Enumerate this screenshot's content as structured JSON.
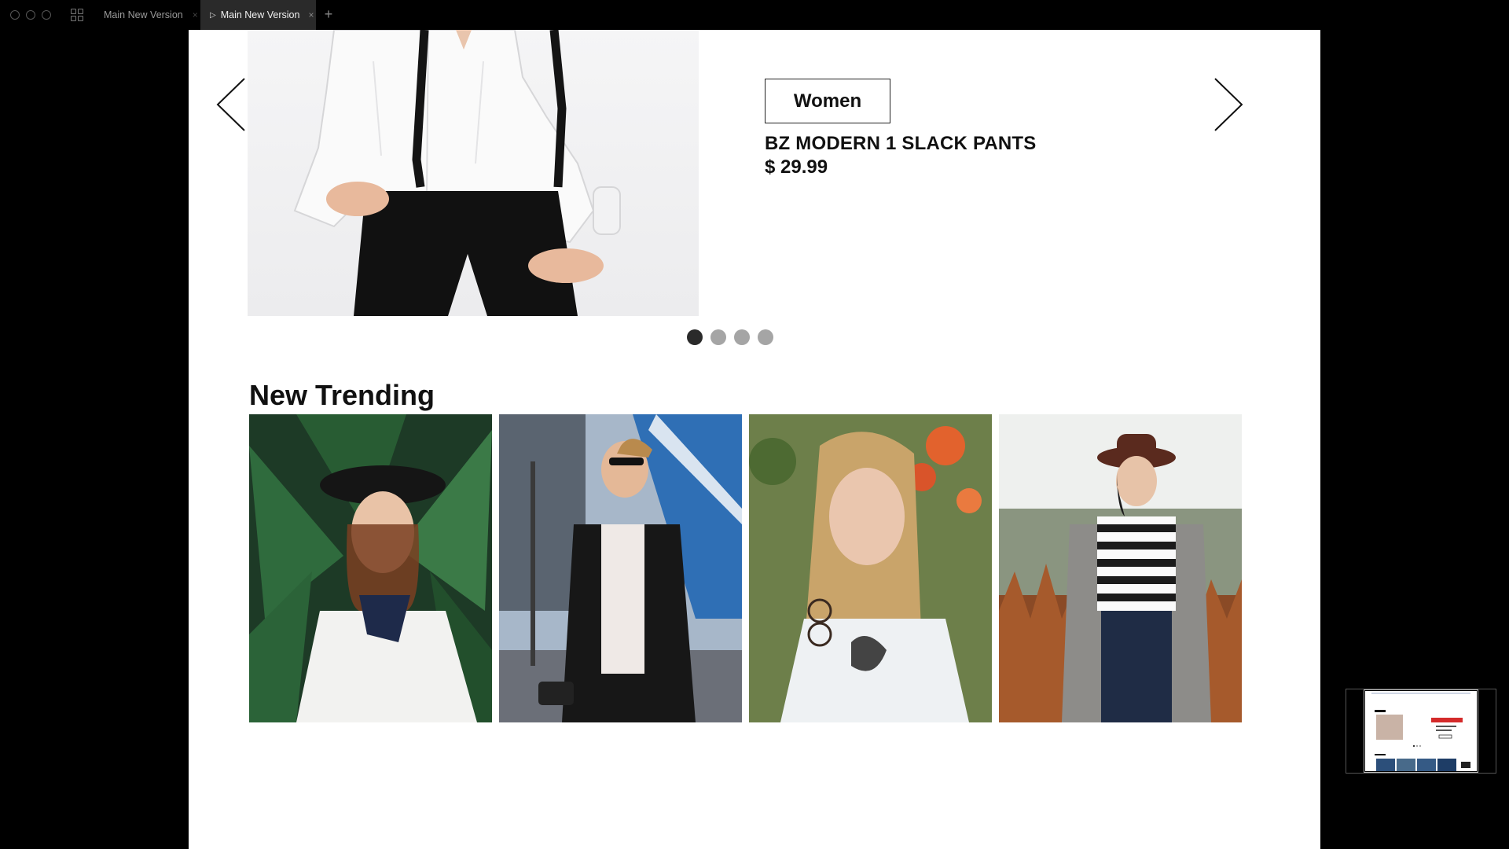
{
  "window": {
    "tabs": [
      {
        "label": "Main New Version",
        "active": false
      },
      {
        "label": "Main New Version",
        "active": true
      }
    ],
    "new_tab_symbol": "+",
    "close_symbol": "×"
  },
  "hero": {
    "category": "Women",
    "product_name": "BZ MODERN 1 SLACK PANTS",
    "price": "$ 29.99",
    "slide_count": 4,
    "active_slide": 1
  },
  "trending": {
    "title": "New Trending",
    "items": [
      {
        "name": "trending-item-1",
        "description": "woman-in-palm-leaves"
      },
      {
        "name": "trending-item-2",
        "description": "man-with-sunglasses-and-camera"
      },
      {
        "name": "trending-item-3",
        "description": "woman-with-glasses-and-flowers"
      },
      {
        "name": "trending-item-4",
        "description": "woman-in-hat-in-field"
      }
    ]
  },
  "icons": {
    "prev": "arrow-left-icon",
    "next": "arrow-right-icon",
    "apps": "grid-icon",
    "play": "play-icon"
  },
  "colors": {
    "canvas": "#ffffff",
    "chrome": "#000000",
    "active_tab": "#2a2a2a",
    "text": "#111111",
    "dot_active": "#2a2a2a",
    "dot_inactive": "#a5a5a5"
  }
}
